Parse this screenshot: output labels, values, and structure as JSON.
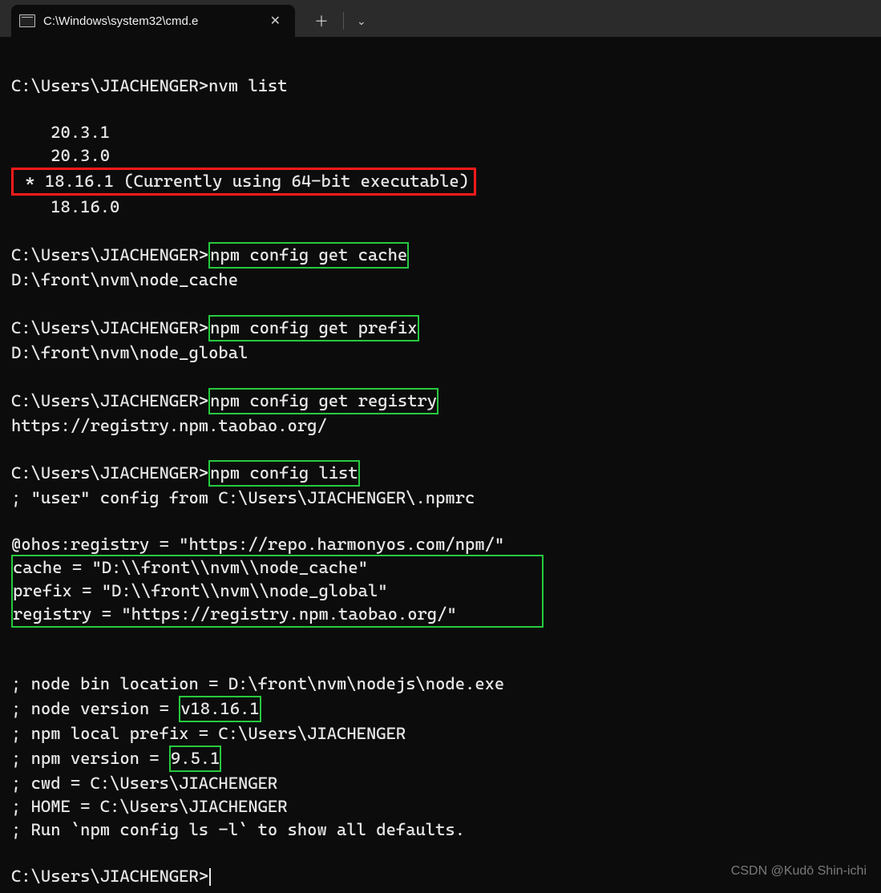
{
  "tab": {
    "title": "C:\\Windows\\system32\\cmd.e",
    "close_glyph": "✕"
  },
  "titlebar": {
    "new_tab_glyph": "＋",
    "dropdown_glyph": "⌄"
  },
  "prompt": "C:\\Users\\JIACHENGER>",
  "nvm_list": {
    "command": "nvm list",
    "versions": {
      "v1": "20.3.1",
      "v2": "20.3.0",
      "current_line": " * 18.16.1 (Currently using 64-bit executable)",
      "v4": "18.16.0"
    }
  },
  "cmd_cache": {
    "command": "npm config get cache",
    "output": "D:\\front\\nvm\\node_cache"
  },
  "cmd_prefix": {
    "command": "npm config get prefix",
    "output": "D:\\front\\nvm\\node_global"
  },
  "cmd_registry": {
    "command": "npm config get registry",
    "output": "https://registry.npm.taobao.org/"
  },
  "cmd_list": {
    "command": "npm config list",
    "user_cfg": "; \"user\" config from C:\\Users\\JIACHENGER\\.npmrc",
    "ohos": "@ohos:registry = \"https://repo.harmonyos.com/npm/\"",
    "block": "cache = \"D:\\\\front\\\\nvm\\\\node_cache\"\nprefix = \"D:\\\\front\\\\nvm\\\\node_global\"\nregistry = \"https://registry.npm.taobao.org/\"",
    "node_bin": "; node bin location = D:\\front\\nvm\\nodejs\\node.exe",
    "node_ver_pre": "; node version = ",
    "node_ver": "v18.16.1",
    "local_prefix": "; npm local prefix = C:\\Users\\JIACHENGER",
    "npm_ver_pre": "; npm version = ",
    "npm_ver": "9.5.1",
    "cwd": "; cwd = C:\\Users\\JIACHENGER",
    "home": "; HOME = C:\\Users\\JIACHENGER",
    "run": "; Run `npm config ls -l` to show all defaults."
  },
  "footer": "CSDN @Kudō Shin-ichi",
  "indent4": "    "
}
